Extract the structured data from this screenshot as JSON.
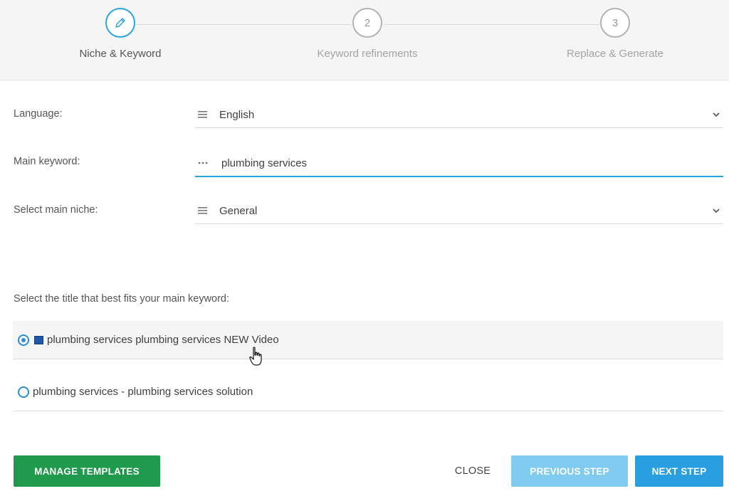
{
  "stepper": {
    "steps": [
      {
        "number": "",
        "label": "Niche & Keyword",
        "icon": "pencil-icon",
        "active": true
      },
      {
        "number": "2",
        "label": "Keyword refinements",
        "active": false
      },
      {
        "number": "3",
        "label": "Replace & Generate",
        "active": false
      }
    ]
  },
  "form": {
    "language": {
      "label": "Language:",
      "value": "English",
      "icon": "list-icon"
    },
    "main_keyword": {
      "label": "Main keyword:",
      "value": "plumbing services",
      "icon": "dots-icon"
    },
    "main_niche": {
      "label": "Select main niche:",
      "value": "General",
      "icon": "list-icon"
    }
  },
  "titles": {
    "prompt": "Select the title that best fits your main keyword:",
    "options": [
      {
        "label": "plumbing services plumbing services NEW Video",
        "selected": true
      },
      {
        "label": "plumbing services - plumbing services solution",
        "selected": false
      }
    ]
  },
  "footer": {
    "manage_templates": "MANAGE TEMPLATES",
    "close": "CLOSE",
    "previous_step": "PREVIOUS STEP",
    "next_step": "NEXT STEP"
  },
  "colors": {
    "accent": "#2aa5da",
    "green_button": "#1f9a4d",
    "prev_button": "#7fccf0",
    "next_button": "#2a9fe0"
  }
}
